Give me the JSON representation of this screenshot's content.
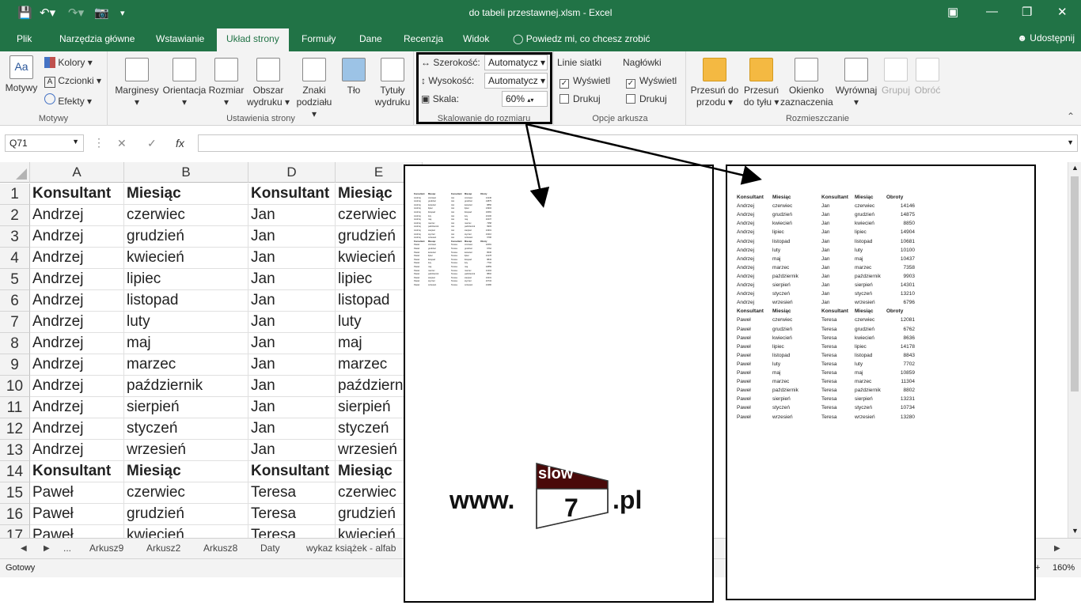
{
  "window": {
    "title": "do tabeli przestawnej.xlsm - Excel",
    "share_label": "Udostępnij"
  },
  "tabs": [
    "Plik",
    "Narzędzia główne",
    "Wstawianie",
    "Układ strony",
    "Formuły",
    "Dane",
    "Recenzja",
    "Widok"
  ],
  "tell_me": "Powiedz mi, co chcesz zrobić",
  "ribbon": {
    "motywy": {
      "motywy": "Motywy",
      "kolory": "Kolory",
      "czcionki": "Czcionki",
      "efekty": "Efekty",
      "group": "Motywy"
    },
    "ustawienia": {
      "marginesy": "Marginesy",
      "orientacja": "Orientacja",
      "rozmiar": "Rozmiar",
      "obszar1": "Obszar",
      "obszar2": "wydruku",
      "znaki1": "Znaki",
      "znaki2": "podziału",
      "tlo": "Tło",
      "tytuly1": "Tytuły",
      "tytuly2": "wydruku",
      "group": "Ustawienia strony"
    },
    "skalowanie": {
      "szerokosc_label": "Szerokość:",
      "szerokosc_value": "Automatycz",
      "wysokosc_label": "Wysokość:",
      "wysokosc_value": "Automatycz",
      "skala_label": "Skala:",
      "skala_value": "60%",
      "group": "Skalowanie do rozmiaru"
    },
    "opcje": {
      "linie": "Linie siatki",
      "naglowki": "Nagłówki",
      "wyswietl": "Wyświetl",
      "drukuj": "Drukuj",
      "group": "Opcje arkusza"
    },
    "rozmieszczanie": {
      "przesun_przod1": "Przesuń do",
      "przesun_przod2": "przodu",
      "przesun_tyl1": "Przesuń",
      "przesun_tyl2": "do tyłu",
      "okienko1": "Okienko",
      "okienko2": "zaznaczenia",
      "wyrownaj": "Wyrównaj",
      "grupuj": "Grupuj",
      "obroc": "Obróć",
      "group": "Rozmieszczanie"
    }
  },
  "formula_bar": {
    "name_box": "Q71",
    "fx": "fx",
    "formula": ""
  },
  "columns": [
    "A",
    "B",
    "D",
    "E"
  ],
  "rows": [
    [
      "Konsultant",
      "Miesiąc",
      "Konsultant",
      "Miesiąc"
    ],
    [
      "Andrzej",
      "czerwiec",
      "Jan",
      "czerwiec"
    ],
    [
      "Andrzej",
      "grudzień",
      "Jan",
      "grudzień"
    ],
    [
      "Andrzej",
      "kwiecień",
      "Jan",
      "kwiecień"
    ],
    [
      "Andrzej",
      "lipiec",
      "Jan",
      "lipiec"
    ],
    [
      "Andrzej",
      "listopad",
      "Jan",
      "listopad"
    ],
    [
      "Andrzej",
      "luty",
      "Jan",
      "luty"
    ],
    [
      "Andrzej",
      "maj",
      "Jan",
      "maj"
    ],
    [
      "Andrzej",
      "marzec",
      "Jan",
      "marzec"
    ],
    [
      "Andrzej",
      "październik",
      "Jan",
      "październik"
    ],
    [
      "Andrzej",
      "sierpień",
      "Jan",
      "sierpień"
    ],
    [
      "Andrzej",
      "styczeń",
      "Jan",
      "styczeń"
    ],
    [
      "Andrzej",
      "wrzesień",
      "Jan",
      "wrzesień"
    ],
    [
      "Konsultant",
      "Miesiąc",
      "Konsultant",
      "Miesiąc"
    ],
    [
      "Paweł",
      "czerwiec",
      "Teresa",
      "czerwiec"
    ],
    [
      "Paweł",
      "grudzień",
      "Teresa",
      "grudzień"
    ],
    [
      "Paweł",
      "kwiecień",
      "Teresa",
      "kwiecień"
    ]
  ],
  "sheet_tabs": [
    "...",
    "Arkusz9",
    "Arkusz2",
    "Arkusz8",
    "Daty",
    "wykaz książek - alfab"
  ],
  "status": {
    "ready": "Gotowy",
    "zoom": "160%"
  },
  "page_preview": {
    "header": [
      "Konsultant",
      "Miesiąc",
      "Konsultant",
      "Miesiąc",
      "Obroty"
    ],
    "block1": [
      [
        "Andrzej",
        "czerwiec",
        "Jan",
        "czerwiec",
        "14146"
      ],
      [
        "Andrzej",
        "grudzień",
        "Jan",
        "grudzień",
        "14875"
      ],
      [
        "Andrzej",
        "kwiecień",
        "Jan",
        "kwiecień",
        "8850"
      ],
      [
        "Andrzej",
        "lipiec",
        "Jan",
        "lipiec",
        "14904"
      ],
      [
        "Andrzej",
        "listopad",
        "Jan",
        "listopad",
        "10681"
      ],
      [
        "Andrzej",
        "luty",
        "Jan",
        "luty",
        "10100"
      ],
      [
        "Andrzej",
        "maj",
        "Jan",
        "maj",
        "10437"
      ],
      [
        "Andrzej",
        "marzec",
        "Jan",
        "marzec",
        "7358"
      ],
      [
        "Andrzej",
        "październik",
        "Jan",
        "październik",
        "9903"
      ],
      [
        "Andrzej",
        "sierpień",
        "Jan",
        "sierpień",
        "14301"
      ],
      [
        "Andrzej",
        "styczeń",
        "Jan",
        "styczeń",
        "13210"
      ],
      [
        "Andrzej",
        "wrzesień",
        "Jan",
        "wrzesień",
        "6796"
      ]
    ],
    "block2": [
      [
        "Paweł",
        "czerwiec",
        "Teresa",
        "czerwiec",
        "12081"
      ],
      [
        "Paweł",
        "grudzień",
        "Teresa",
        "grudzień",
        "6762"
      ],
      [
        "Paweł",
        "kwiecień",
        "Teresa",
        "kwiecień",
        "8636"
      ],
      [
        "Paweł",
        "lipiec",
        "Teresa",
        "lipiec",
        "14178"
      ],
      [
        "Paweł",
        "listopad",
        "Teresa",
        "listopad",
        "8843"
      ],
      [
        "Paweł",
        "luty",
        "Teresa",
        "luty",
        "7702"
      ],
      [
        "Paweł",
        "maj",
        "Teresa",
        "maj",
        "10859"
      ],
      [
        "Paweł",
        "marzec",
        "Teresa",
        "marzec",
        "11304"
      ],
      [
        "Paweł",
        "październik",
        "Teresa",
        "październik",
        "8802"
      ],
      [
        "Paweł",
        "sierpień",
        "Teresa",
        "sierpień",
        "13231"
      ],
      [
        "Paweł",
        "styczeń",
        "Teresa",
        "styczeń",
        "10734"
      ],
      [
        "Paweł",
        "wrzesień",
        "Teresa",
        "wrzesień",
        "13280"
      ]
    ]
  },
  "logo": {
    "prefix": "www.",
    "top": "slow",
    "number": "7",
    "suffix": ".pl"
  }
}
